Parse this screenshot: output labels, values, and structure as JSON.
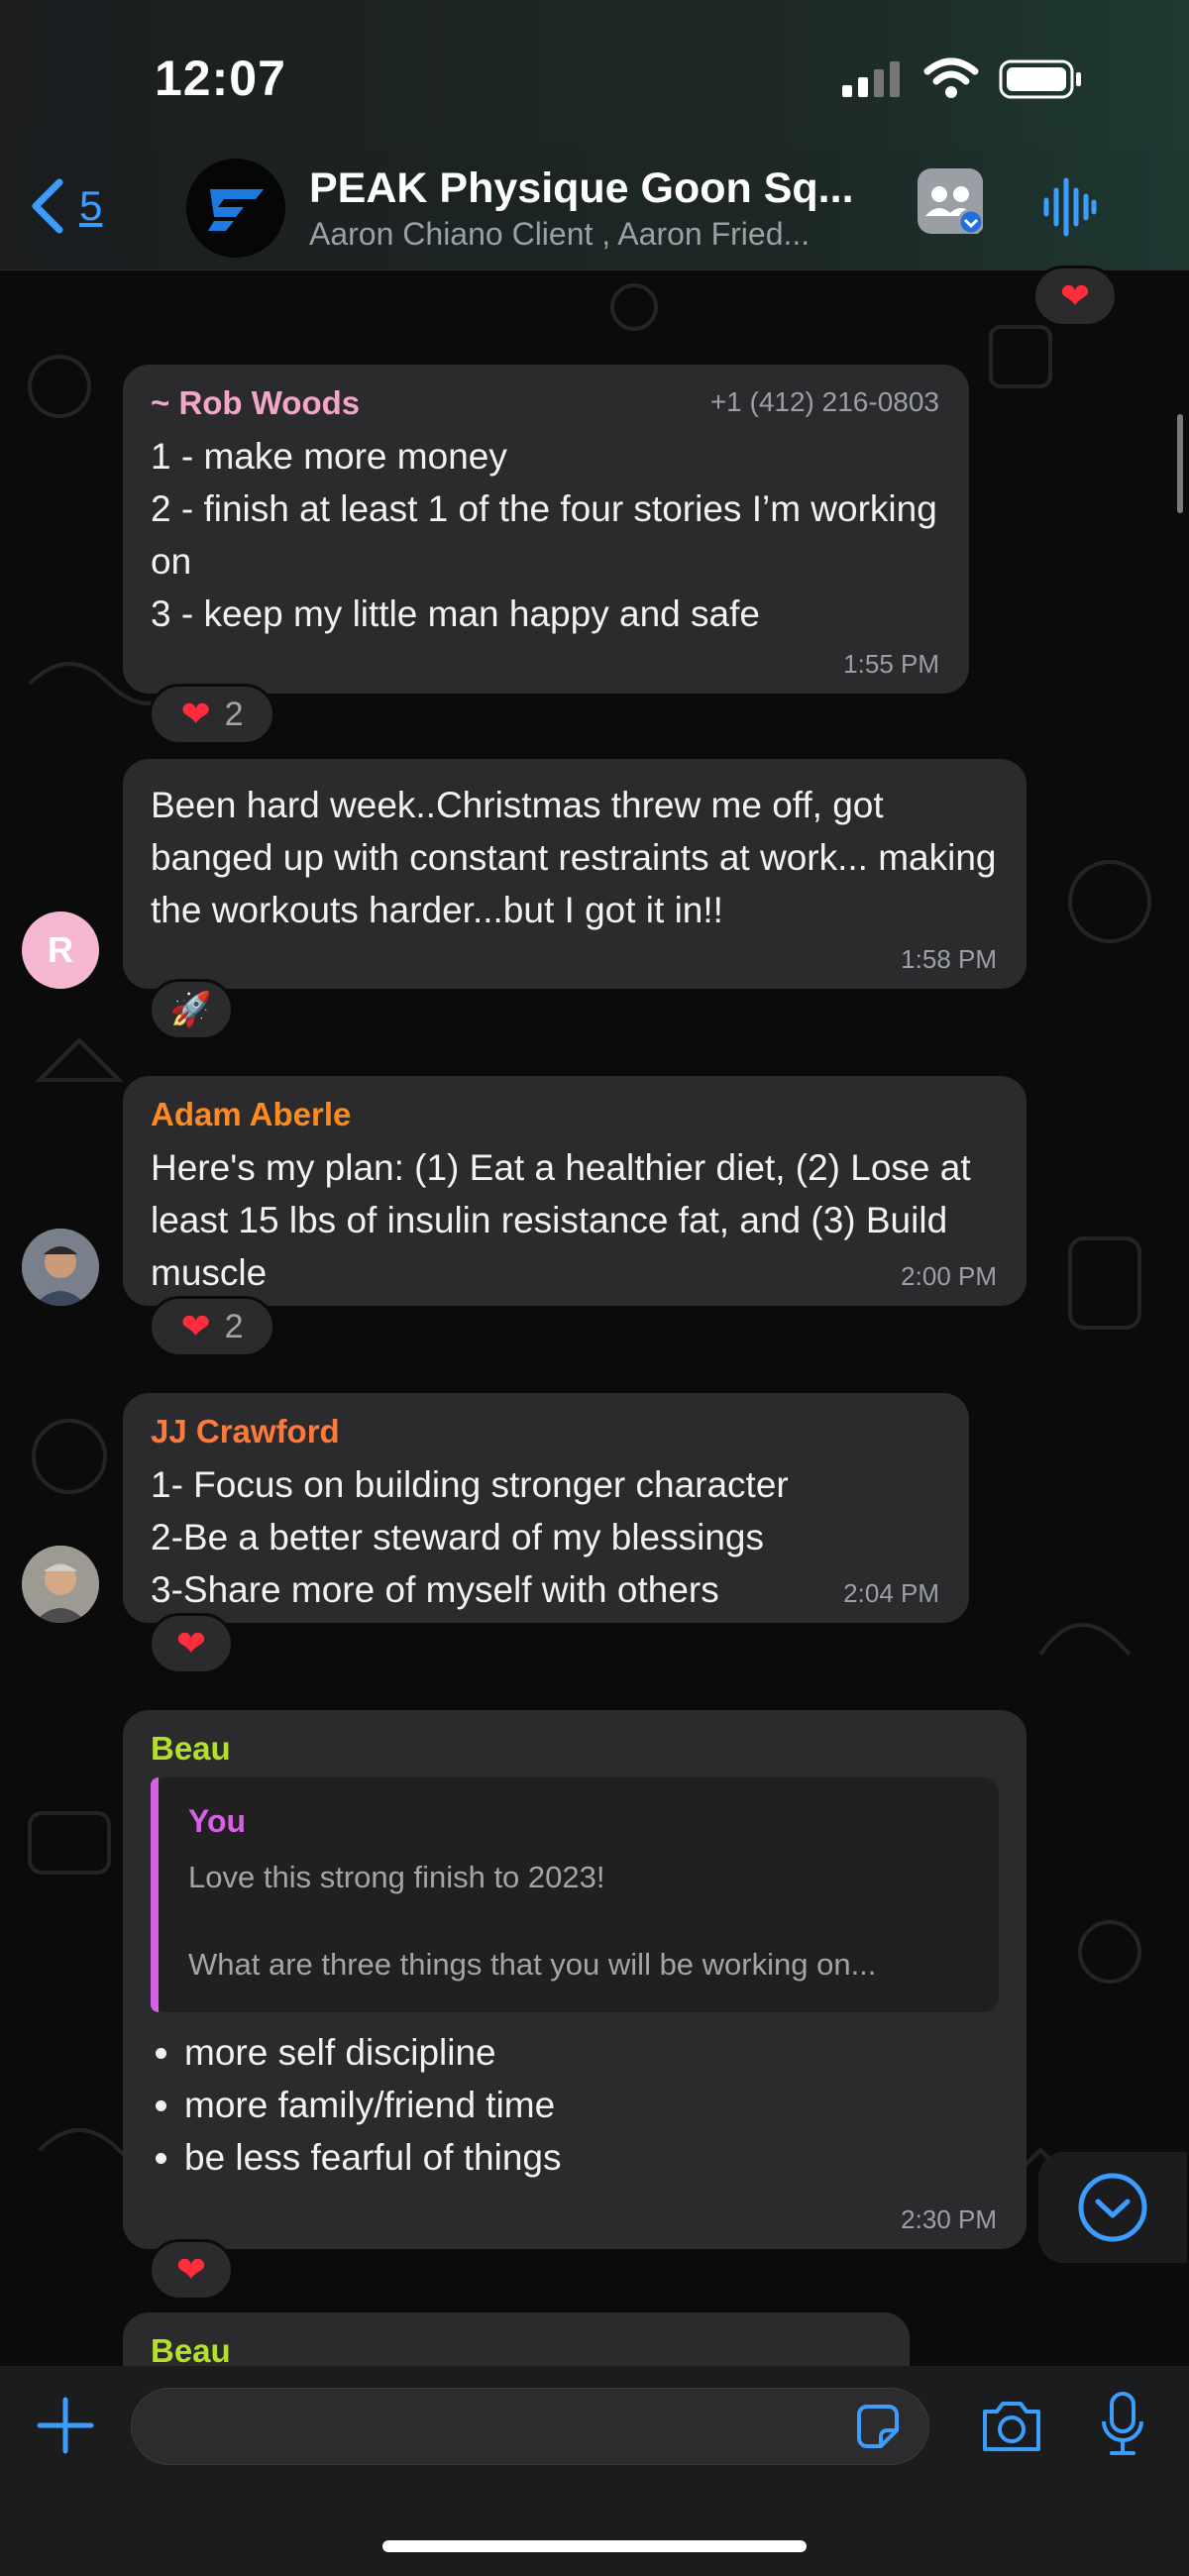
{
  "status_bar": {
    "time": "12:07"
  },
  "header": {
    "back_count": "5",
    "title": "PEAK Physique Goon Sq...",
    "subtitle": "Aaron Chiano Client , Aaron Fried..."
  },
  "messages": [
    {
      "sender": "~ Rob Woods",
      "sender_color": "#f3a6c8",
      "phone": "+1 (412) 216-0803",
      "lines": [
        "1 - make more money",
        "2 - finish at least 1 of the four stories I’m working on",
        "3 - keep my little man happy and safe"
      ],
      "time": "1:55 PM",
      "reaction_count": "2"
    },
    {
      "avatar_letter": "R",
      "text": "Been hard week..Christmas threw me off, got banged up with constant restraints at work... making the workouts harder...but I got it in!!",
      "time": "1:58 PM",
      "reaction_emoji": "🚀"
    },
    {
      "sender": "Adam Aberle",
      "sender_color": "#ff8a1d",
      "text": "Here's my plan: (1) Eat a healthier diet, (2) Lose at least 15 lbs of insulin resistance fat, and (3) Build muscle",
      "time": "2:00 PM",
      "reaction_count": "2"
    },
    {
      "sender": "JJ Crawford",
      "sender_color": "#ff7a3a",
      "lines": [
        "1- Focus on building stronger character",
        "2-Be a better steward of my blessings",
        "3-Share more of myself with others"
      ],
      "time": "2:04 PM"
    },
    {
      "sender": "Beau",
      "sender_color": "#b5e02a",
      "quote": {
        "name": "You",
        "line1": "Love this strong finish to 2023!",
        "line2": "What are three things that you will be working on..."
      },
      "bullets": [
        "more self discipline",
        "more family/friend time",
        "be less fearful of things"
      ],
      "time": "2:30 PM"
    },
    {
      "sender": "Beau",
      "sender_color": "#b5e02a"
    }
  ],
  "icons": {
    "back": "chevron-left-icon",
    "group": "group-icon",
    "voice": "waveform-icon",
    "plus": "plus-icon",
    "sticker": "sticker-icon",
    "camera": "camera-icon",
    "mic": "microphone-icon",
    "scroll": "chevron-down-icon"
  },
  "colors": {
    "accent": "#3b9eff",
    "bubble": "#2b2b2d",
    "heart": "#ff2d3c"
  }
}
